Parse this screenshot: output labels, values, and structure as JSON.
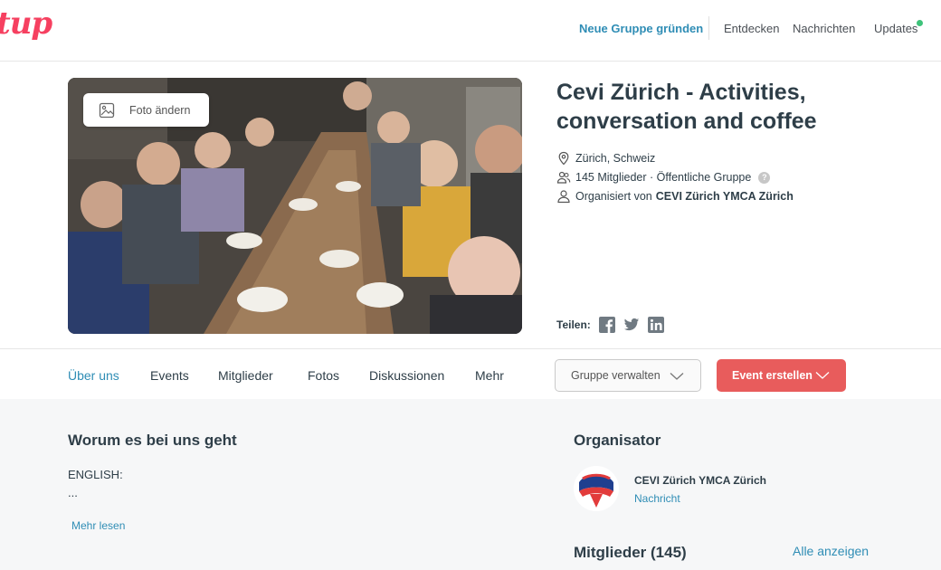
{
  "brand": {
    "logo_text": "tup",
    "accent": "#f64060",
    "link_color": "#2f8db5"
  },
  "topnav": {
    "new_group": "Neue Gruppe gründen",
    "links": [
      "Entdecken",
      "Nachrichten",
      "Updates"
    ],
    "updates_indicator_color": "#3ec37a"
  },
  "hero": {
    "photo_button": "Foto ändern",
    "title": "Cevi Zürich - Activities, conversation and coffee",
    "location": "Zürich, Schweiz",
    "members_info": "145 Mitglieder · Öffentliche Gruppe",
    "help_icon": "?",
    "organized_by_prefix": "Organisiert von",
    "organizer_name": "CEVI Zürich YMCA Zürich",
    "share_label": "Teilen:",
    "share_icons": [
      "facebook-icon",
      "twitter-icon",
      "linkedin-icon"
    ]
  },
  "tabs": {
    "items": [
      "Über uns",
      "Events",
      "Mitglieder",
      "Fotos",
      "Diskussionen",
      "Mehr"
    ],
    "active": "Über uns",
    "manage_button": "Gruppe verwalten",
    "create_event_button": "Event erstellen",
    "create_event_color": "#e85c5c"
  },
  "about": {
    "heading": "Worum es bei uns geht",
    "line1": "ENGLISH:",
    "line2": "...",
    "read_more": "Mehr lesen"
  },
  "organizer": {
    "heading": "Organisator",
    "name": "CEVI Zürich YMCA Zürich",
    "message_link": "Nachricht"
  },
  "members": {
    "heading": "Mitglieder (145)",
    "see_all": "Alle anzeigen"
  }
}
